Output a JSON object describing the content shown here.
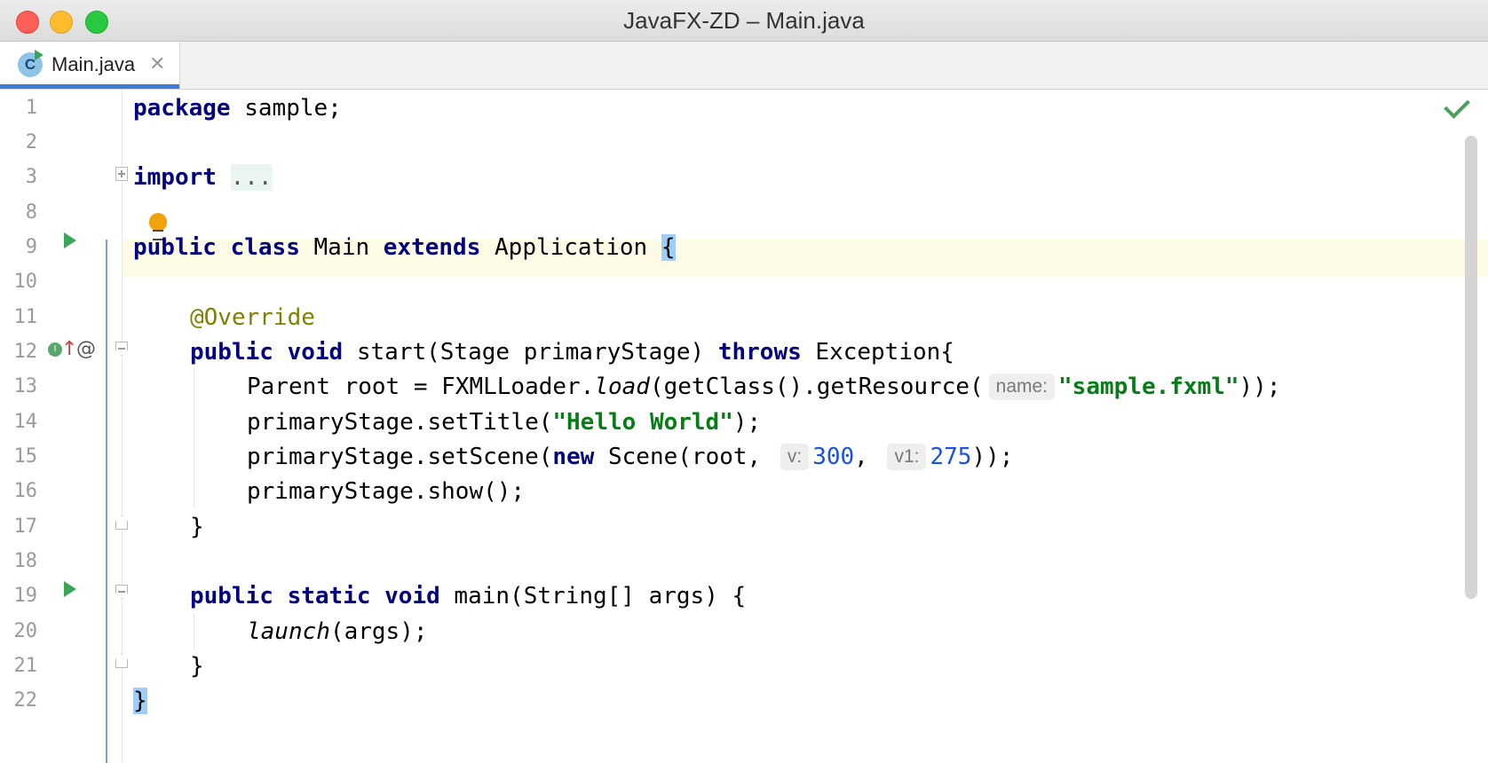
{
  "window": {
    "title": "JavaFX-ZD – Main.java"
  },
  "tabs": [
    {
      "label": "Main.java",
      "icon": "C"
    }
  ],
  "editor": {
    "lines": [
      {
        "num": "1"
      },
      {
        "num": "2"
      },
      {
        "num": "3"
      },
      {
        "num": "8"
      },
      {
        "num": "9"
      },
      {
        "num": "10"
      },
      {
        "num": "11"
      },
      {
        "num": "12"
      },
      {
        "num": "13"
      },
      {
        "num": "14"
      },
      {
        "num": "15"
      },
      {
        "num": "16"
      },
      {
        "num": "17"
      },
      {
        "num": "18"
      },
      {
        "num": "19"
      },
      {
        "num": "20"
      },
      {
        "num": "21"
      },
      {
        "num": "22"
      }
    ],
    "code": {
      "l1_kw": "package",
      "l1_rest": " sample;",
      "l3_kw": "import",
      "l3_fold": "...",
      "l9_kw1": "public",
      "l9_kw2": "class",
      "l9_name": " Main ",
      "l9_kw3": "extends",
      "l9_rest": " Application ",
      "l9_brace": "{",
      "l11_ann": "@Override",
      "l12_kw1": "public",
      "l12_kw2": "void",
      "l12_mid": " start(Stage primaryStage) ",
      "l12_kw3": "throws",
      "l12_rest": " Exception{",
      "l13_a": "Parent root = FXMLLoader.",
      "l13_it": "load",
      "l13_b": "(getClass().getResource(",
      "l13_hint": "name:",
      "l13_str": "\"sample.fxml\"",
      "l13_end": "));",
      "l14_a": "primaryStage.setTitle(",
      "l14_str": "\"Hello World\"",
      "l14_end": ");",
      "l15_a": "primaryStage.setScene(",
      "l15_kw": "new",
      "l15_b": " Scene(root, ",
      "l15_hint1": "v:",
      "l15_num1": "300",
      "l15_c": ", ",
      "l15_hint2": "v1:",
      "l15_num2": "275",
      "l15_end": "));",
      "l16": "primaryStage.show();",
      "l17": "}",
      "l19_kw1": "public",
      "l19_kw2": "static",
      "l19_kw3": "void",
      "l19_rest": " main(String[] args) {",
      "l20_it": "launch",
      "l20_rest": "(args);",
      "l21": "}",
      "l22": "}"
    }
  },
  "icons": {
    "tab_file": "java-class-run-icon",
    "close": "close-icon",
    "run": "run-gutter-icon",
    "bulb": "intention-bulb-icon",
    "status": "inspection-ok-icon"
  }
}
